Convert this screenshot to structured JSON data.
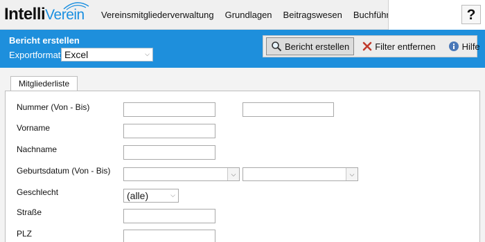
{
  "logo": {
    "part1": "Intelli",
    "part2": "Verein"
  },
  "nav": {
    "items": [
      "Vereinsmitgliederverwaltung",
      "Grundlagen",
      "Beitragswesen",
      "Buchführung"
    ],
    "help_label": "?"
  },
  "header": {
    "title": "Bericht erstellen",
    "export_label": "Exportformat",
    "export_value": "Excel"
  },
  "toolbar": {
    "create_report": "Bericht erstellen",
    "remove_filter": "Filter entfernen",
    "help": "Hilfe"
  },
  "tabs": {
    "active": "Mitgliederliste"
  },
  "form": {
    "nummer": "Nummer (Von - Bis)",
    "vorname": "Vorname",
    "nachname": "Nachname",
    "geburtsdatum": "Geburtsdatum (Von - Bis)",
    "geschlecht": "Geschlecht",
    "geschlecht_value": "(alle)",
    "strasse": "Straße",
    "plz": "PLZ"
  },
  "colors": {
    "accent": "#1e8fdc",
    "logo_blue": "#1a8fe0"
  },
  "icons": [
    "magnifier-icon",
    "x-icon",
    "info-icon",
    "chevron-down-icon"
  ]
}
